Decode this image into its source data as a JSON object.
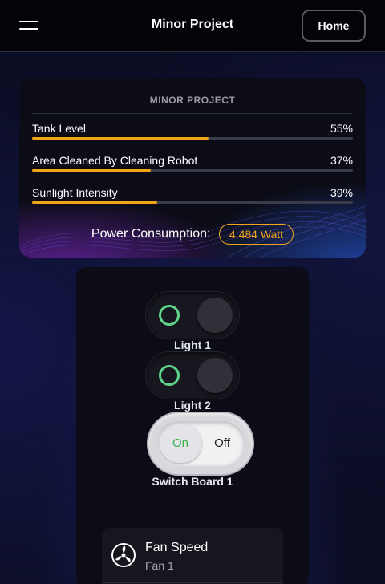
{
  "header": {
    "title": "Minor Project",
    "home_label": "Home"
  },
  "status_card": {
    "heading": "MINOR PROJECT",
    "metrics": [
      {
        "label": "Tank Level",
        "value": "55%",
        "fraction": 0.55
      },
      {
        "label": "Area Cleaned By Cleaning Robot",
        "value": "37%",
        "fraction": 0.37
      },
      {
        "label": "Sunlight Intensity",
        "value": "39%",
        "fraction": 0.39
      }
    ],
    "power_label": "Power Consumption:",
    "power_value": "4.484 Watt"
  },
  "controls": {
    "light1": {
      "label": "Light 1"
    },
    "light2": {
      "label": "Light 2"
    },
    "switch_board": {
      "label": "Switch Board 1",
      "on_text": "On",
      "off_text": "Off",
      "state": "on"
    }
  },
  "fan": {
    "title": "Fan Speed",
    "subtitle": "Fan 1"
  },
  "colors": {
    "accent": "#f2a516",
    "toggle_ring": "#5fd38a",
    "switch_on_text": "#36b34a"
  },
  "icons": {
    "menu": "hamburger-menu-icon",
    "fan": "fan-icon"
  }
}
